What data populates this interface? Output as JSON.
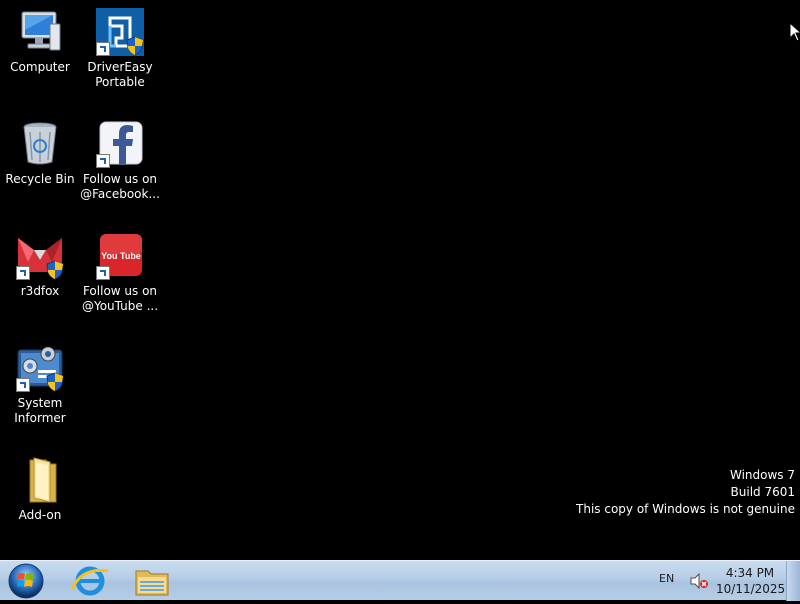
{
  "desktop": {
    "icons": [
      {
        "label": "Computer",
        "icon": "computer-icon"
      },
      {
        "label": "DriverEasy\nPortable",
        "icon": "drivereasy-icon"
      },
      {
        "label": "Recycle Bin",
        "icon": "recycle-bin-icon"
      },
      {
        "label": "Follow us on\n@Facebook...",
        "icon": "facebook-icon"
      },
      {
        "label": "r3dfox",
        "icon": "r3dfox-icon"
      },
      {
        "label": "Follow us on\n@YouTube ...",
        "icon": "youtube-icon"
      },
      {
        "label": "System\nInformer",
        "icon": "system-informer-icon"
      },
      {
        "label": "Add-on",
        "icon": "folder-icon"
      }
    ]
  },
  "watermark": {
    "line1": "Windows 7",
    "line2": "Build 7601",
    "line3": "This copy of Windows is not genuine"
  },
  "taskbar": {
    "start": "windows-start-orb",
    "pinned": [
      "internet-explorer-icon",
      "windows-explorer-icon"
    ],
    "language": "EN",
    "time": "4:34 PM",
    "date": "10/11/2025"
  },
  "youtube_text": "You Tube"
}
